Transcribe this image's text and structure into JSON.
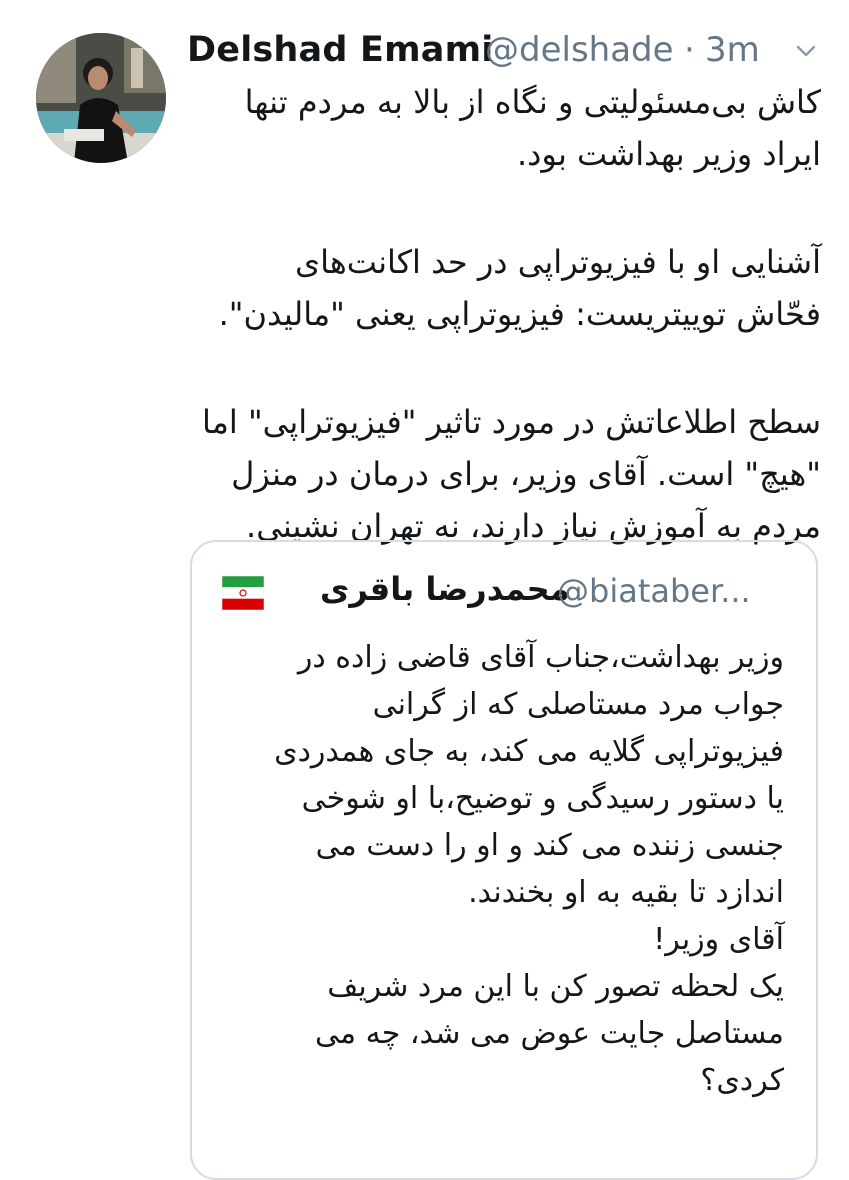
{
  "tweet": {
    "author_name": "Delshad Emami",
    "author_handle": "@delshade",
    "separator": "·",
    "time": "3m",
    "paragraphs": [
      [
        "کاش بی‌مسئولیتی و نگاه از بالا به مردم تنها",
        "ایراد وزیر بهداشت بود."
      ],
      [
        "آشنایی او با فیزیوتراپی در حد اکانت‌های",
        "فحّاش توییتریست: فیزیوتراپی یعنی \"مالیدن\"."
      ],
      [
        "سطح اطلاعاتش در مورد تاثیر \"فیزیوتراپی\" اما",
        "\"هیچ\" است. آقای وزیر، برای درمان در منزل",
        "مردم به آموزش نیاز دارند، نه تهران نشینی."
      ]
    ]
  },
  "quoted_tweet": {
    "author_name": "محمدرضا باقری",
    "author_handle": "@biataber...",
    "flag": "iran-flag-icon",
    "lines": [
      "وزیر بهداشت،جناب آقای قاضی زاده  در",
      "جواب مرد مستاصلی که از گرانی",
      "فیزیوتراپی گلایه می کند، به جای همدردی",
      "یا دستور رسیدگی و توضیح،با او شوخی",
      "جنسی زننده می کند و  او را دست می",
      "اندازد تا بقیه به او بخندند.",
      "آقای وزیر!",
      "یک لحظه تصور کن با این مرد شریف",
      "مستاصل جایت عوض می شد، چه می",
      "کردی؟"
    ]
  },
  "colors": {
    "text": "#14171a",
    "secondary": "#657786",
    "border": "#d5dce2"
  }
}
